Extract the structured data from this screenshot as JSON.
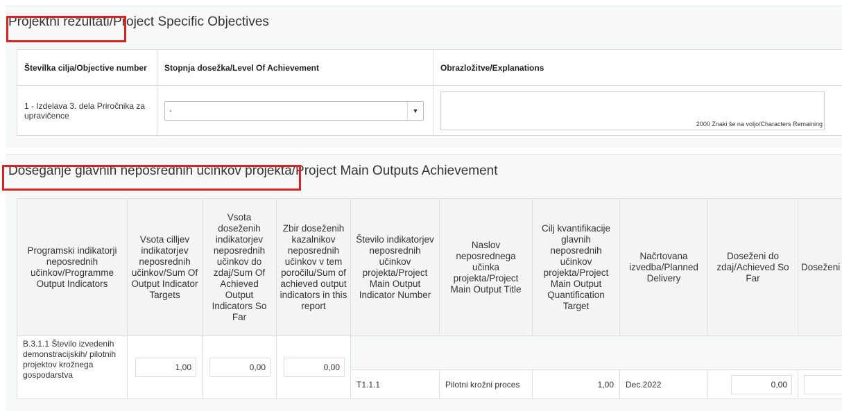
{
  "objectives_section": {
    "title": "Projektni rezultati/Project Specific Objectives",
    "headers": {
      "objective_number": "Številka cilja/Objective number",
      "level": "Stopnja dosežka/Level Of Achievement",
      "explanations": "Obrazložitve/Explanations"
    },
    "row": {
      "objective": "1 - Izdelava 3. dela Priročnika za upravičence",
      "level_value": "-",
      "chars_remaining": "2000 Znaki še na voljo/Characters Remaining"
    }
  },
  "outputs_section": {
    "title": "Doseganje glavnih neposrednih učinkov projekta/Project Main Outputs Achievement",
    "headers": [
      "Programski indikatorji neposrednih učinkov/Programme Output Indicators",
      "Vsota cilljev indikatorjev neposrednih učinkov/Sum Of Output Indicator Targets",
      "Vsota doseženih indikatorjev neposrednih učinkov do zdaj/Sum Of Achieved Output Indicators So Far",
      "Zbir doseženih kazalnikov neposrednih učinkov v tem poročilu/Sum of achieved output indicators in this report",
      "Število indikatorjev neposrednih učinkov projekta/Project Main Output Indicator Number",
      "Naslov neposrednega učinka projekta/Project Main Output Title",
      "Cilj kvantifikacije glavnih neposrednih učinkov projekta/Project Main Output Quantification Target",
      "Načrtovana izvedba/Planned Delivery",
      "Doseženi do zdaj/Achieved So Far",
      "Doseženi v tem poročilu/Achieved in this report"
    ],
    "row": {
      "indicator": "B.3.1.1 Število izvedenih demonstracijskih/ pilotnih projektov krožnega gospodarstva",
      "sum_targets": "1,00",
      "sum_achieved": "0,00",
      "sum_report": "0,00",
      "output_number": "T1.1.1",
      "output_title": "Pilotni krožni proces",
      "quant_target": "1,00",
      "planned_delivery": "Dec.2022",
      "achieved_so_far": "0,00",
      "achieved_report": ""
    }
  }
}
